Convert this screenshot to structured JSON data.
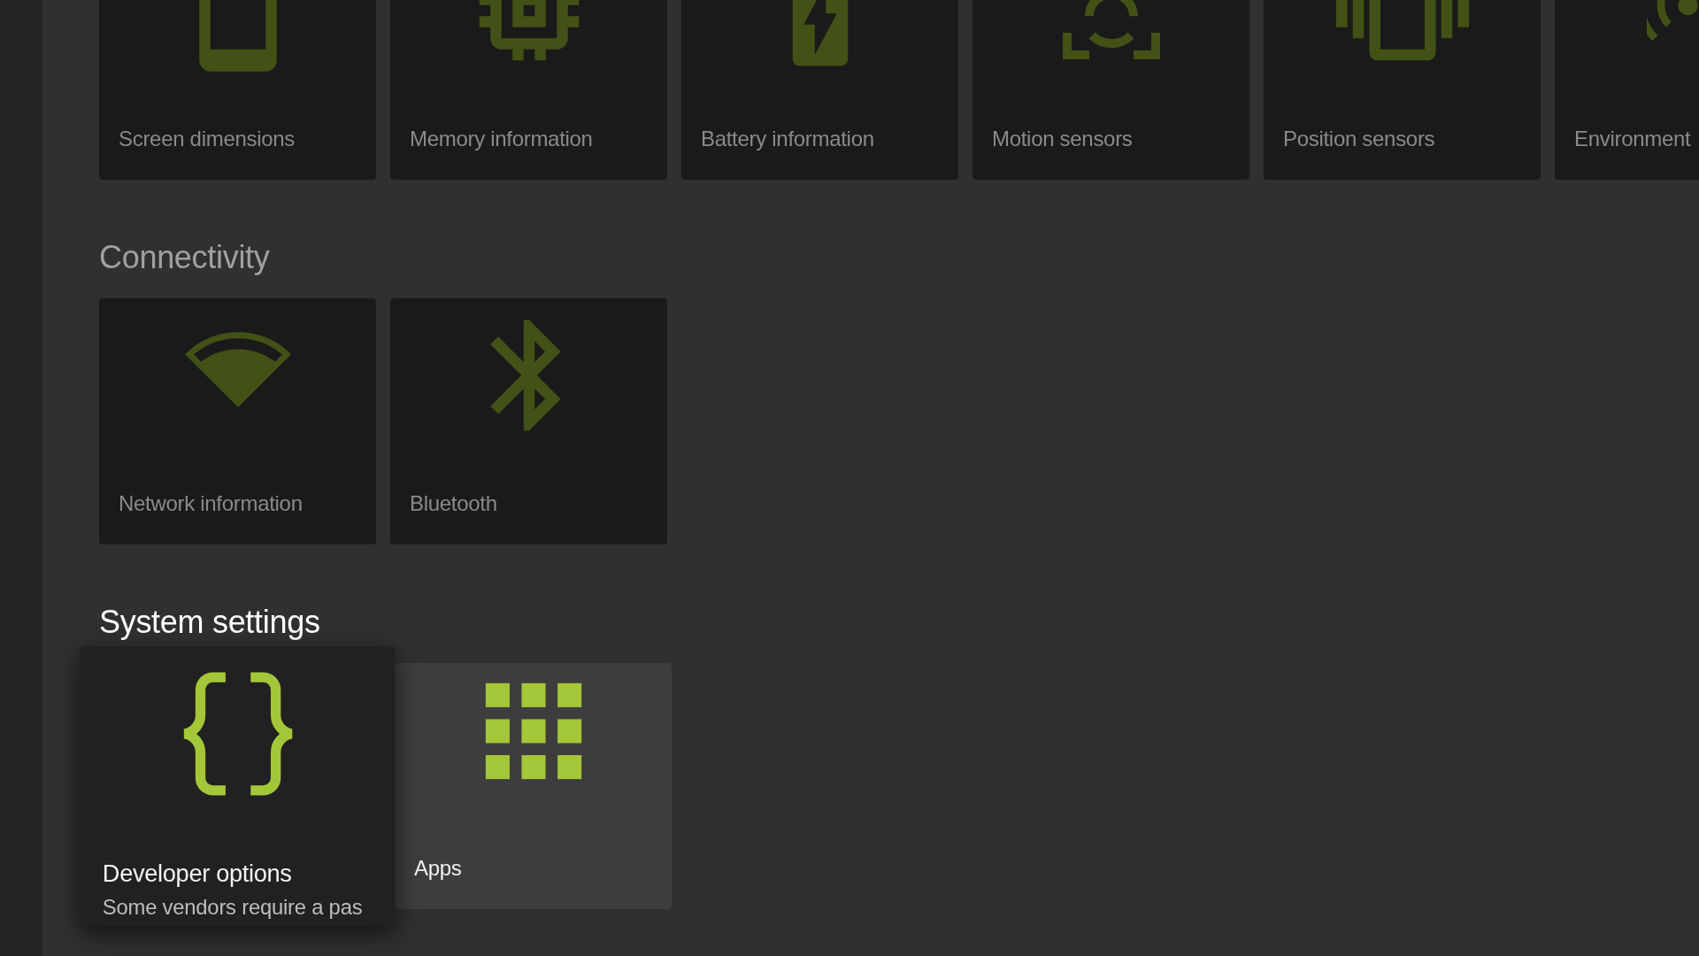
{
  "sections": [
    {
      "active": false,
      "items": [
        {
          "kind": "phone",
          "label": "Screen dimensions",
          "selected": false
        },
        {
          "kind": "chip",
          "label": "Memory information",
          "selected": false
        },
        {
          "kind": "battery",
          "label": "Battery information",
          "selected": false
        },
        {
          "kind": "motion",
          "label": "Motion sensors",
          "selected": false
        },
        {
          "kind": "vibrate",
          "label": "Position sensors",
          "selected": false
        },
        {
          "kind": "waves",
          "label": "Environment",
          "selected": false
        }
      ]
    },
    {
      "title": "Connectivity",
      "active": false,
      "items": [
        {
          "kind": "wifi",
          "label": "Network information",
          "selected": false
        },
        {
          "kind": "bluetooth",
          "label": "Bluetooth",
          "selected": false
        }
      ]
    },
    {
      "title": "System settings",
      "active": true,
      "items": [
        {
          "kind": "braces",
          "label": "Developer options",
          "subtitle": "Some vendors require a pas",
          "selected": true
        },
        {
          "kind": "grid",
          "label": "Apps",
          "selected": false
        }
      ]
    }
  ]
}
